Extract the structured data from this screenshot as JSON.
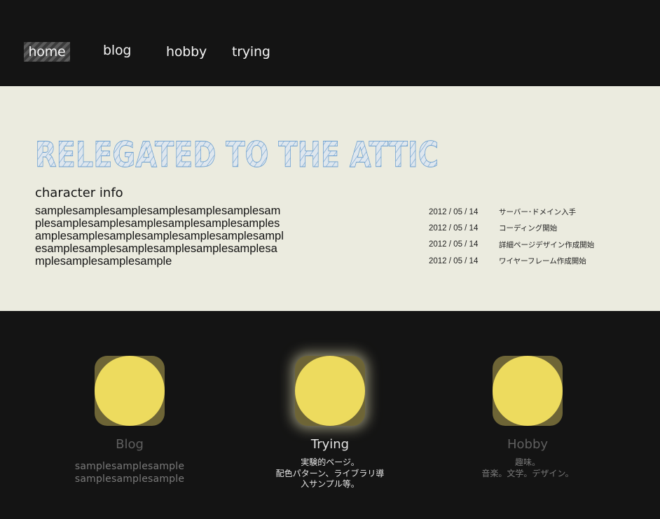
{
  "nav": {
    "items": [
      {
        "label": "home",
        "active": true
      },
      {
        "label": "blog",
        "active": false
      },
      {
        "label": "hobby",
        "active": false
      },
      {
        "label": "trying",
        "active": false
      }
    ]
  },
  "hero": {
    "logo_text": "RELEGATED TO THE ATTIC",
    "info_title": "character info",
    "info_lines": [
      "samplesamplesamplesamplesamplesamplesam",
      "plesamplesamplesamplesamplesamplesamples",
      "amplesamplesamplesamplesamplesamplesampl",
      "esamplesamplesamplesamplesamplesamplesa",
      "mplesamplesamplesample"
    ]
  },
  "news": [
    {
      "date": "2012 / 05 / 14",
      "text": "サーバー･ドメイン入手"
    },
    {
      "date": "2012 / 05 / 14",
      "text": "コーディング開始"
    },
    {
      "date": "2012 / 05 / 14",
      "text": "詳細ページデザイン作成開始"
    },
    {
      "date": "2012 / 05 / 14",
      "text": "ワイヤーフレーム作成開始"
    }
  ],
  "cards": [
    {
      "title": "Blog",
      "desc_lines": [
        "samplesamplesample",
        "samplesamplesample"
      ],
      "icon": "circle-icon"
    },
    {
      "title": "Trying",
      "desc_lines": [
        "実験的ページ。",
        "配色パターン、ライブラリ導",
        "入サンプル等。"
      ],
      "icon": "circle-icon"
    },
    {
      "title": "Hobby",
      "desc_lines": [
        "趣味。",
        "音楽。文学。デザイン。"
      ],
      "icon": "circle-icon"
    }
  ],
  "colors": {
    "background_dark": "#141414",
    "background_light": "#ebebdf",
    "accent_yellow": "#eddb5e",
    "logo_blue": "#6a9ecf"
  }
}
